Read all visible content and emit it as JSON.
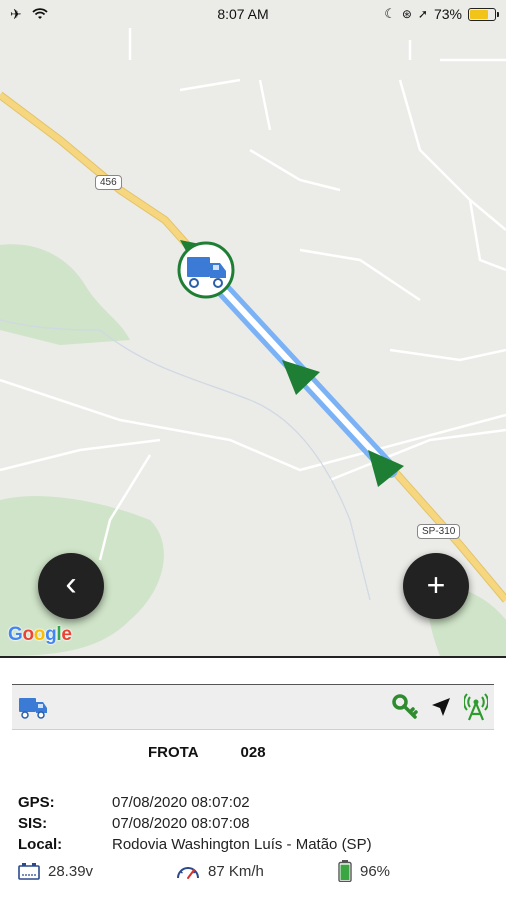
{
  "status_bar": {
    "time": "8:07 AM",
    "battery_percent": "73%",
    "battery_level": 0.73,
    "icons": [
      "airplane-icon",
      "wifi-icon",
      "moon-icon",
      "orientation-lock-icon",
      "location-arrow-icon",
      "battery-icon"
    ]
  },
  "map": {
    "road_shields": [
      "456",
      "SP-310"
    ],
    "google_logo": "Google",
    "vehicle_marker_icon": "truck-icon",
    "direction_markers": 3,
    "colors": {
      "route": "#7ab2f5",
      "highway": "#f6d67f",
      "marker_green": "#1e7e34"
    }
  },
  "buttons": {
    "back_label": "‹",
    "add_label": "+"
  },
  "vehicle_bar": {
    "icons": [
      "truck-icon",
      "key-icon",
      "navigation-arrow-icon",
      "signal-tower-icon"
    ],
    "key_color": "#2e8b2e",
    "signal_color": "#2e9b2e"
  },
  "vehicle": {
    "frota_label": "FROTA",
    "frota_number": "028"
  },
  "details": {
    "gps_label": "GPS:",
    "gps_value": "07/08/2020 08:07:02",
    "sis_label": "SIS:",
    "sis_value": "07/08/2020 08:07:08",
    "local_label": "Local:",
    "local_value": "Rodovia Washington Luís - Matão (SP)"
  },
  "metrics": {
    "voltage": "28.39v",
    "speed": "87 Km/h",
    "battery": "96%",
    "battery_level": 0.96
  }
}
